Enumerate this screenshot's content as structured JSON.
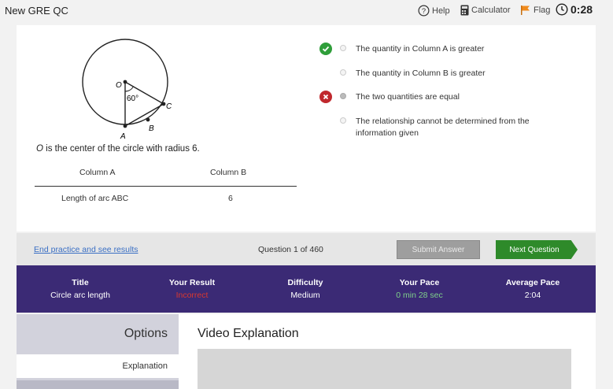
{
  "header": {
    "title": "New GRE QC",
    "help_label": "Help",
    "calculator_label": "Calculator",
    "flag_label": "Flag",
    "timer": "0:28"
  },
  "question": {
    "diagram_labels": {
      "center": "O",
      "angle": "60°",
      "point_a": "A",
      "point_b": "B",
      "point_c": "C"
    },
    "caption_var": "O",
    "caption_rest": " is the center of the circle with radius 6.",
    "column_a_header": "Column A",
    "column_b_header": "Column B",
    "column_a_value": "Length of arc ABC",
    "column_b_value": "6"
  },
  "choices": [
    {
      "text": "The quantity in Column A is greater",
      "selected": false,
      "mark": "correct"
    },
    {
      "text": "The quantity in Column B is greater",
      "selected": false,
      "mark": ""
    },
    {
      "text": "The two quantities are equal",
      "selected": true,
      "mark": "incorrect"
    },
    {
      "text": "The relationship cannot be determined from the information given",
      "selected": false,
      "mark": ""
    }
  ],
  "colors": {
    "correct": "#2f9e3a",
    "incorrect": "#c0282d",
    "stats_bg": "#3b2a75",
    "next_button": "#2e8a2a",
    "link": "#3a6fc4",
    "flag": "#f08a1c"
  },
  "actions": {
    "end_link": "End practice and see results",
    "question_count": "Question 1 of 460",
    "submit_label": "Submit Answer",
    "next_label": "Next Question"
  },
  "stats": [
    {
      "label": "Title",
      "value": "Circle arc length",
      "value_color": "#ffffff"
    },
    {
      "label": "Your Result",
      "value": "Incorrect",
      "value_color": "#d9382f"
    },
    {
      "label": "Difficulty",
      "value": "Medium",
      "value_color": "#ffffff"
    },
    {
      "label": "Your Pace",
      "value": "0 min 28 sec",
      "value_color": "#7fd08a"
    },
    {
      "label": "Average Pace",
      "value": "2:04",
      "value_color": "#ffffff"
    }
  ],
  "options_panel": {
    "title": "Options",
    "tab_label": "Explanation"
  },
  "explanation": {
    "title": "Video Explanation"
  }
}
